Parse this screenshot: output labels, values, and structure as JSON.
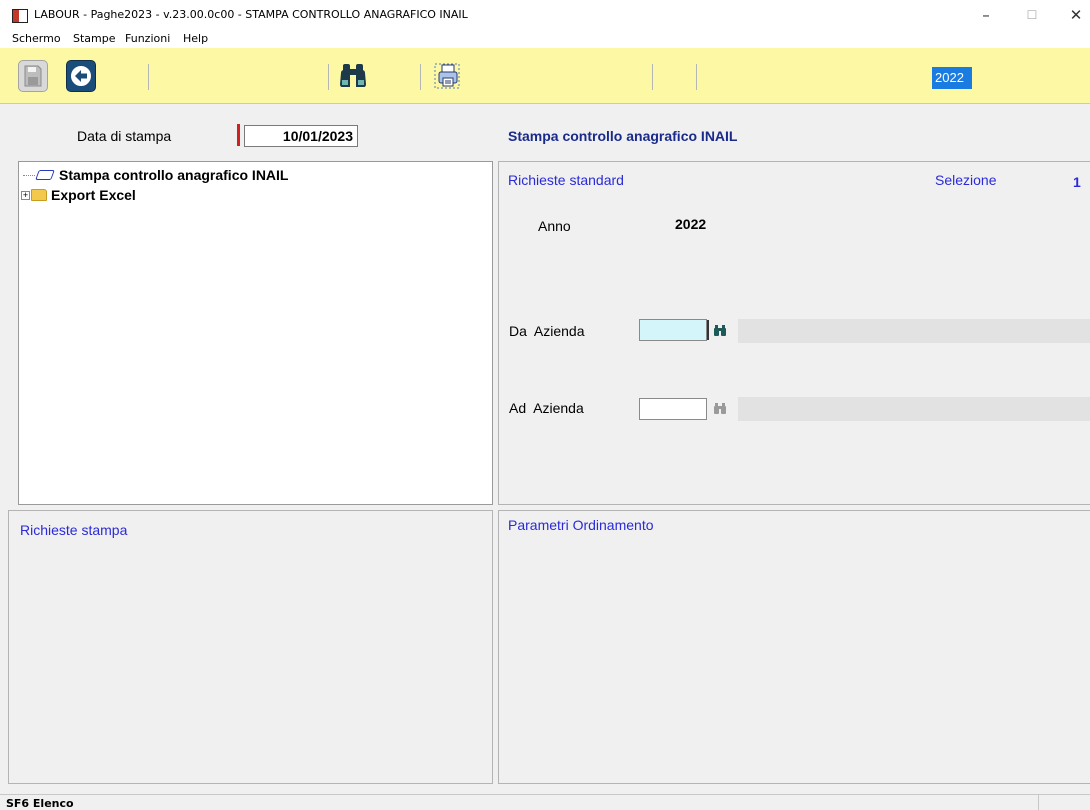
{
  "window": {
    "title": "LABOUR - Paghe2023 - v.23.00.0c00 - STAMPA CONTROLLO ANAGRAFICO INAIL",
    "minimize": "–",
    "maximize": "☐",
    "close": "✕"
  },
  "menu": [
    {
      "label": "Schermo"
    },
    {
      "label": "Stampe"
    },
    {
      "label": "Funzioni"
    },
    {
      "label": "Help"
    }
  ],
  "toolbar": {
    "save_icon": "floppy-disk-icon",
    "exit_icon": "back-arrow-icon",
    "find_icon": "binoculars-icon",
    "print_icon": "print-preview-icon",
    "year": "2022",
    "accent": "#fcf8a4"
  },
  "header": {
    "date_label": "Data di stampa",
    "date_value": "10/01/2023",
    "section_title": "Stampa controllo anagrafico INAIL"
  },
  "tree": {
    "items": [
      {
        "label": "Stampa controllo anagrafico INAIL",
        "icon": "document-icon",
        "expandable": false
      },
      {
        "label": "Export Excel",
        "icon": "folder-icon",
        "expandable": true
      }
    ]
  },
  "standard": {
    "title": "Richieste standard",
    "selection_label": "Selezione",
    "selection_value": "1",
    "anno_label": "Anno",
    "anno_value": "2022",
    "da_azienda_label": "Da  Azienda",
    "da_azienda_value": "",
    "ad_azienda_label": "Ad  Azienda",
    "ad_azienda_value": ""
  },
  "panels": {
    "print_requests": "Richieste stampa",
    "sort_params": "Parametri Ordinamento"
  },
  "status": {
    "text": "SF6 Elenco"
  }
}
